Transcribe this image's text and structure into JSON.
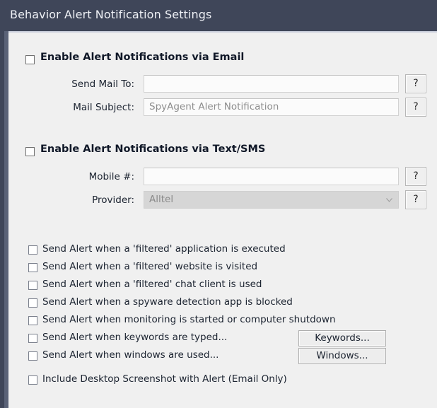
{
  "window": {
    "title": "Behavior Alert Notification Settings"
  },
  "email_section": {
    "enable_label": "Enable Alert Notifications via Email",
    "enabled": false,
    "fields": [
      {
        "label": "Send Mail To:",
        "value": "",
        "placeholder": "",
        "help_label": "?"
      },
      {
        "label": "Mail Subject:",
        "value": "SpyAgent Alert Notification",
        "placeholder": "SpyAgent Alert Notification",
        "help_label": "?"
      }
    ]
  },
  "sms_section": {
    "enable_label": "Enable Alert Notifications via Text/SMS",
    "enabled": false,
    "mobile": {
      "label": "Mobile #:",
      "value": "",
      "help_label": "?"
    },
    "provider": {
      "label": "Provider:",
      "value": "Alltel",
      "help_label": "?",
      "disabled": true
    }
  },
  "alert_options": [
    {
      "label": "Send Alert when a 'filtered' application is executed",
      "checked": false
    },
    {
      "label": "Send Alert when a 'filtered' website is visited",
      "checked": false
    },
    {
      "label": "Send Alert when a 'filtered' chat client is used",
      "checked": false
    },
    {
      "label": "Send Alert when a spyware detection app is blocked",
      "checked": false
    },
    {
      "label": "Send Alert when monitoring is started or computer shutdown",
      "checked": false
    },
    {
      "label": "Send Alert when keywords are typed...",
      "checked": false,
      "button": "Keywords..."
    },
    {
      "label": "Send Alert when windows are used...",
      "checked": false,
      "button": "Windows..."
    }
  ],
  "screenshot_option": {
    "label": "Include Desktop Screenshot with Alert (Email Only)",
    "checked": false
  },
  "colors": {
    "titlebar": "#3f4659",
    "panel": "#f0f0f0",
    "edge_light": "#5a6277",
    "text": "#1b2330",
    "placeholder": "#8d8d8d"
  }
}
